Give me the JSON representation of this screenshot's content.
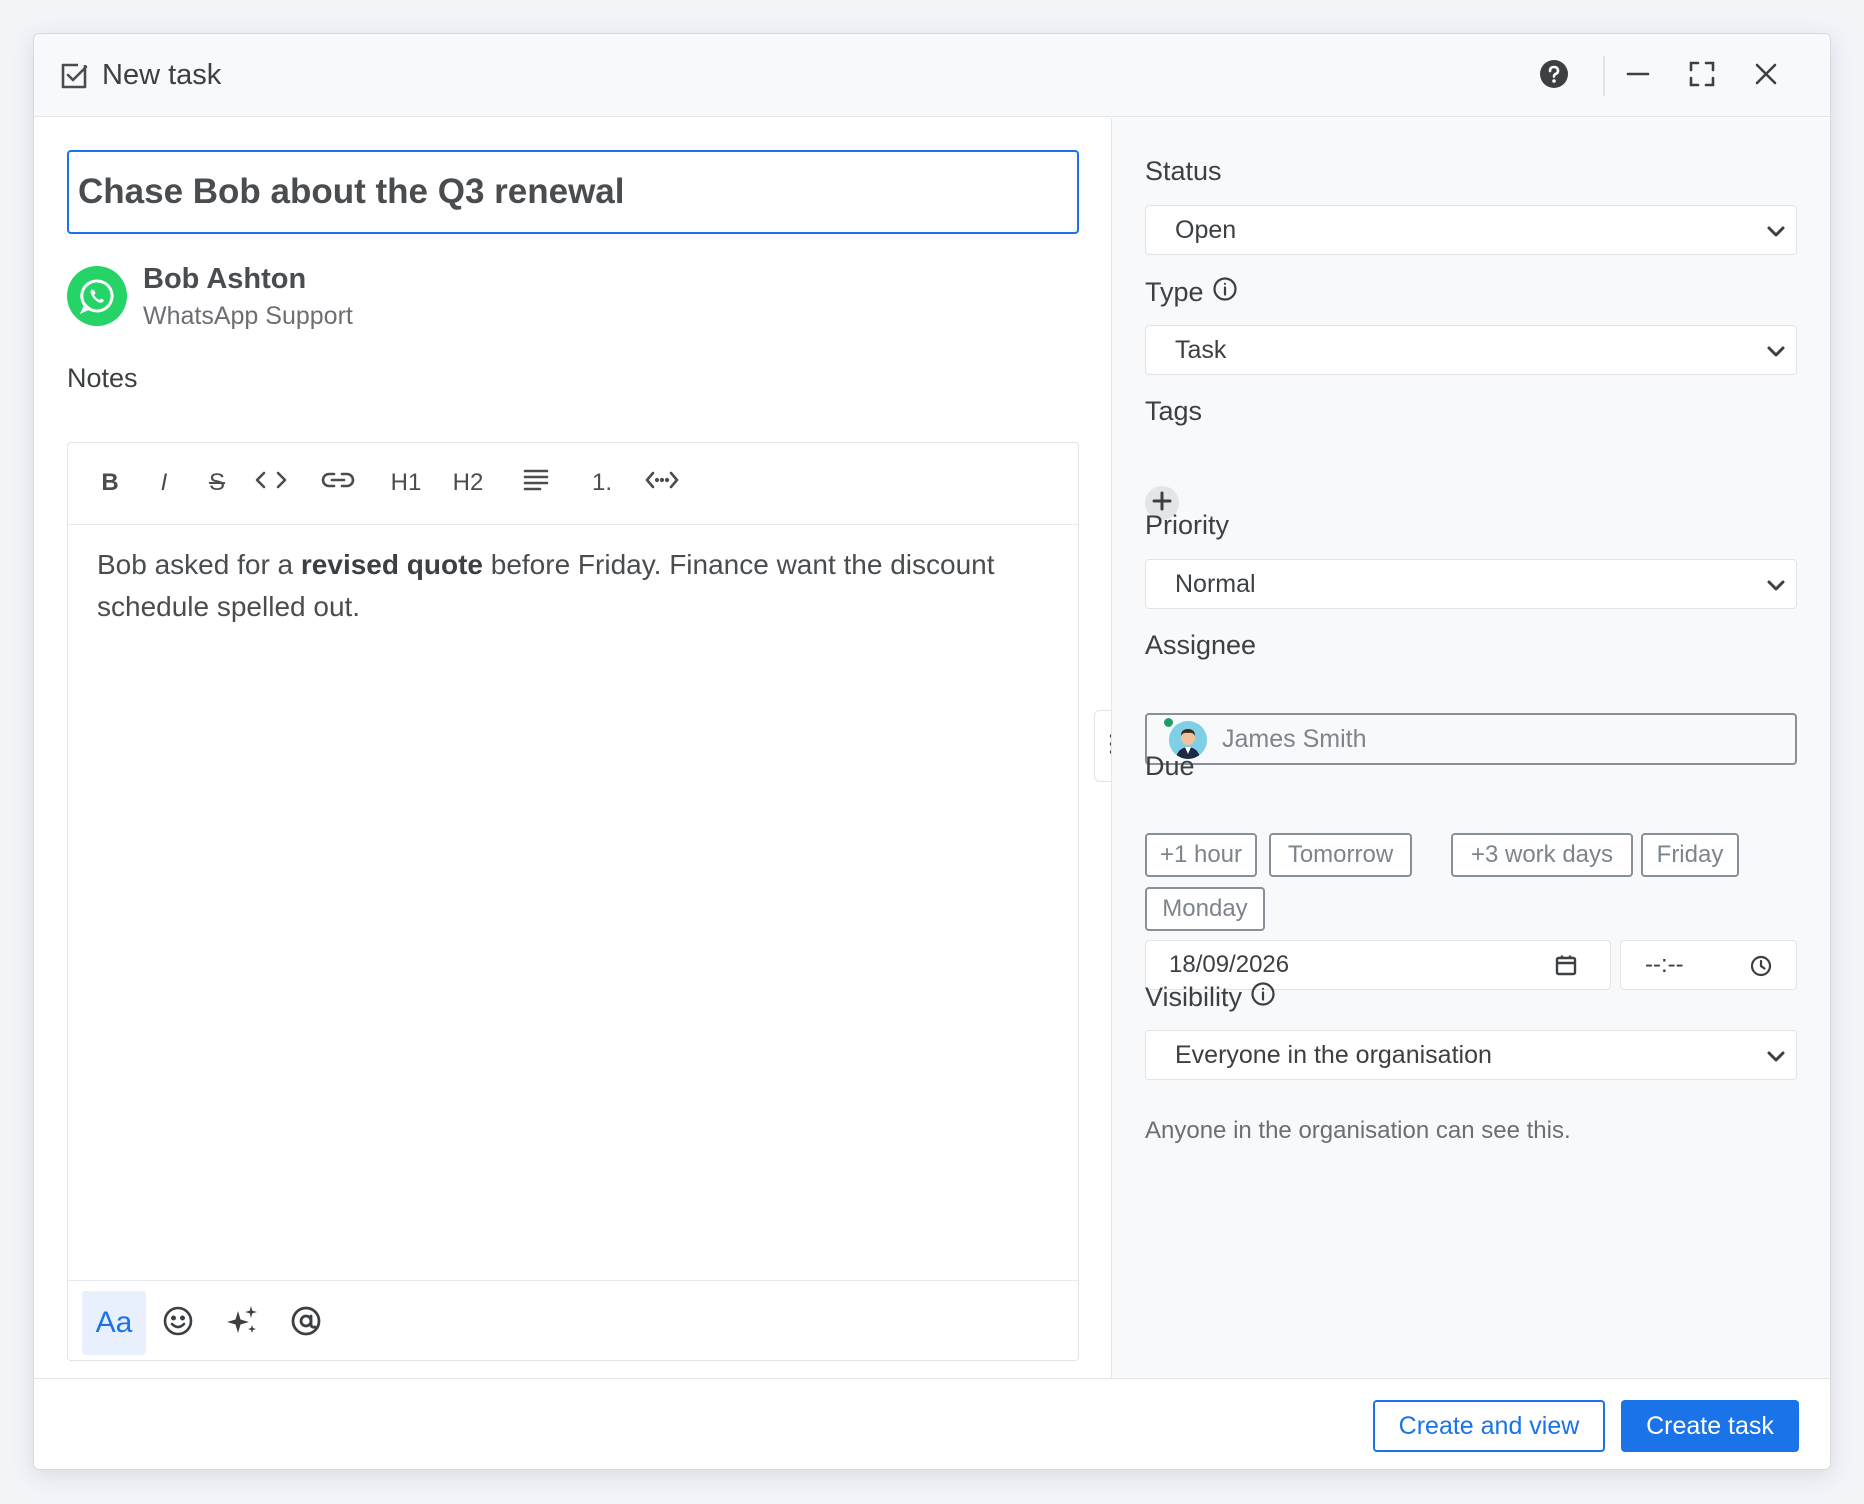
{
  "window": {
    "title": "New task",
    "title_icon": "checkbox-icon",
    "controls": [
      "help-icon",
      "minimize-icon",
      "maximize-icon",
      "close-icon"
    ]
  },
  "task": {
    "title": "Chase Bob about the Q3 renewal"
  },
  "contact": {
    "name": "Bob Ashton",
    "channel": "WhatsApp Support",
    "channel_icon": "whatsapp-icon",
    "channel_color": "#25d366"
  },
  "notes": {
    "label": "Notes",
    "toolbar": {
      "bold": "B",
      "italic": "I",
      "strike": "S",
      "h1": "H1",
      "h2": "H2",
      "ordered_list": "1."
    },
    "content": {
      "part1": "Bob asked for a ",
      "bold": "revised quote",
      "part2": " before Friday. Finance want the discount schedule spelled out."
    },
    "bottom_toolbar": {
      "format_label": "Aa"
    }
  },
  "sidebar": {
    "status": {
      "label": "Status",
      "value": "Open"
    },
    "type": {
      "label": "Type",
      "value": "Task"
    },
    "tags": {
      "label": "Tags"
    },
    "priority": {
      "label": "Priority",
      "value": "Normal"
    },
    "assignee": {
      "label": "Assignee",
      "value": "James Smith",
      "online_color": "#1e9e6a"
    },
    "due": {
      "label": "Due",
      "chips": [
        "+1 hour",
        "Tomorrow",
        "+3 work days",
        "Friday",
        "Monday"
      ],
      "date": "18/09/2026",
      "time": "--:--"
    },
    "visibility": {
      "label": "Visibility",
      "value": "Everyone in the organisation",
      "note": "Anyone in the organisation can see this."
    }
  },
  "footer": {
    "secondary_label": "Create and view",
    "primary_label": "Create task",
    "accent_color": "#1a73e8"
  }
}
